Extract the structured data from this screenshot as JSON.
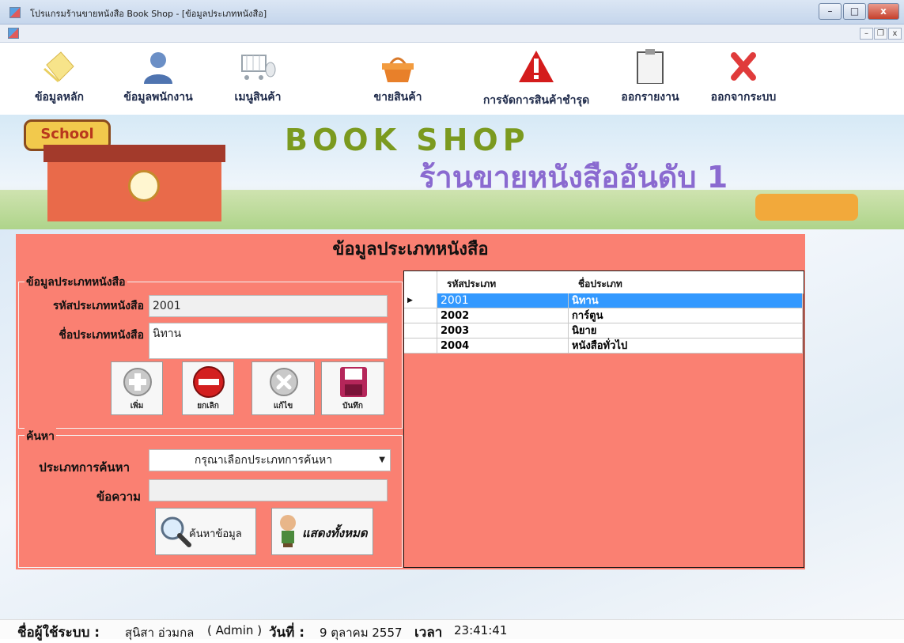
{
  "window": {
    "title": "โปรแกรมร้านขายหนังสือ Book Shop - [ข้อมูลประเภทหนังสือ]",
    "caption_buttons": {
      "minimize": "–",
      "maximize": "□",
      "close": "x"
    },
    "mdi_buttons": {
      "minimize": "–",
      "restore": "❐",
      "close": "x"
    }
  },
  "toolbar": {
    "items": [
      {
        "label": "ข้อมูลหลัก",
        "icon": "note-icon"
      },
      {
        "label": "ข้อมูลพนักงาน",
        "icon": "person-icon"
      },
      {
        "label": "เมนูสินค้า",
        "icon": "cart-mouse-icon"
      },
      {
        "label": "ขายสินค้า",
        "icon": "basket-icon"
      },
      {
        "label": "การจัดการสินค้าชำรุด",
        "icon": "warning-icon"
      },
      {
        "label": "ออกรายงาน",
        "icon": "clipboard-icon"
      },
      {
        "label": "ออกจากระบบ",
        "icon": "close-icon"
      }
    ]
  },
  "banner": {
    "school_sign": "School",
    "title": "BOOK SHOP",
    "subtitle": "ร้านขายหนังสืออันดับ 1"
  },
  "form": {
    "title": "ข้อมูลประเภทหนังสือ",
    "group_info": {
      "legend": "ข้อมูลประเภทหนังสือ",
      "code_label": "รหัสประเภทหนังสือ",
      "code_value": "2001",
      "name_label": "ชื่อประเภทหนังสือ",
      "name_value": "นิทาน"
    },
    "buttons": {
      "add": "เพิ่ม",
      "cancel": "ยกเลิก",
      "edit": "แก้ไข",
      "save": "บันทึก"
    },
    "group_search": {
      "legend": "ค้นหา",
      "type_label": "ประเภทการค้นหา",
      "type_selected": "กรุณาเลือกประเภทการค้นหา",
      "text_label": "ข้อความ",
      "text_value": "",
      "search_button": "ค้นหาข้อมูล",
      "show_all_button": "แสดงทั้งหมด"
    },
    "grid": {
      "columns": [
        "รหัสประเภท",
        "ชื่อประเภท"
      ],
      "rows": [
        {
          "code": "2001",
          "name": "นิทาน"
        },
        {
          "code": "2002",
          "name": "การ์ตูน"
        },
        {
          "code": "2003",
          "name": "นิยาย"
        },
        {
          "code": "2004",
          "name": "หนังสือทั่วไป"
        }
      ],
      "selected_row": 0
    }
  },
  "status": {
    "user_label": "ชื่อผู้ใช้ระบบ :",
    "user_value": "สุนิสา อ่วมกล",
    "role": "( Admin )",
    "date_label": "วันที่ :",
    "date_value": "9 ตุลาคม 2557",
    "time_label": "เวลา",
    "time_value": "23:41:41"
  },
  "colors": {
    "form_bg": "#fa8072",
    "selected_row": "#3399ff",
    "toolbar_text": "#1e2a4a"
  }
}
